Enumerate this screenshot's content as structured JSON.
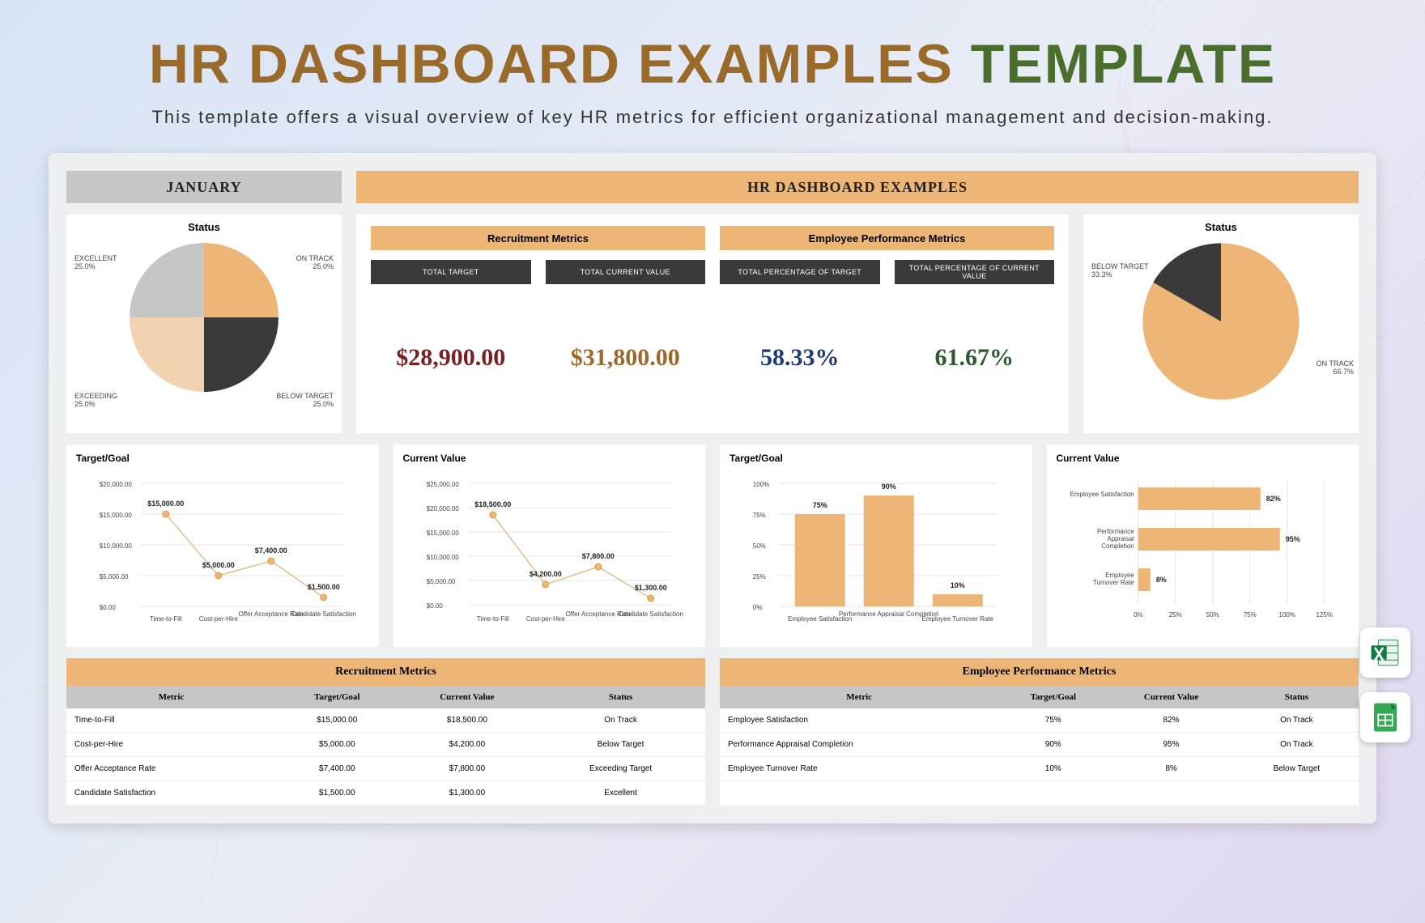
{
  "header": {
    "title_main": "HR DASHBOARD EXAMPLES",
    "title_accent": "TEMPLATE",
    "subtitle": "This template offers a visual overview of key HR metrics for efficient organizational management and decision-making."
  },
  "top": {
    "month": "JANUARY",
    "main_header": "HR DASHBOARD EXAMPLES"
  },
  "pie1": {
    "title": "Status",
    "labels": {
      "excellent": "EXCELLENT",
      "excellent_pct": "25.0%",
      "on_track": "ON TRACK",
      "on_track_pct": "25.0%",
      "exceeding": "EXCEEDING",
      "exceeding_pct": "25.0%",
      "below": "BELOW TARGET",
      "below_pct": "25.0%"
    }
  },
  "pie2": {
    "title": "Status",
    "labels": {
      "below": "BELOW TARGET",
      "below_pct": "33.3%",
      "on_track": "ON TRACK",
      "on_track_pct": "66.7%"
    }
  },
  "metrics": {
    "group1": "Recruitment Metrics",
    "group2": "Employee Performance Metrics",
    "c1_sub": "TOTAL TARGET",
    "c1_val": "$28,900.00",
    "c2_sub": "TOTAL CURRENT VALUE",
    "c2_val": "$31,800.00",
    "c3_sub": "TOTAL PERCENTAGE OF TARGET",
    "c3_val": "58.33%",
    "c4_sub": "TOTAL PERCENTAGE OF CURRENT VALUE",
    "c4_val": "61.67%"
  },
  "mini1": {
    "title": "Target/Goal",
    "xcats": [
      "Time-to-Fill",
      "Cost-per-Hire",
      "Offer Acceptance Rate",
      "Candidate Satisfaction"
    ],
    "labels": [
      "$15,000.00",
      "$5,000.00",
      "$7,400.00",
      "$1,500.00"
    ]
  },
  "mini2": {
    "title": "Current Value",
    "xcats": [
      "Time-to-Fill",
      "Cost-per-Hire",
      "Offer Acceptance Rate",
      "Candidate Satisfaction"
    ],
    "labels": [
      "$18,500.00",
      "$4,200.00",
      "$7,800.00",
      "$1,300.00"
    ]
  },
  "mini3": {
    "title": "Target/Goal",
    "xcats": [
      "Employee Satisfaction",
      "Performance Appraisal Completion",
      "Employee Turnover Rate"
    ],
    "labels": [
      "75%",
      "90%",
      "10%"
    ]
  },
  "mini4": {
    "title": "Current Value",
    "ycats": [
      "Employee Satisfaction",
      "Performance Appraisal Completion",
      "Employee Turnover Rate"
    ],
    "labels": [
      "82%",
      "95%",
      "8%"
    ]
  },
  "tbl1": {
    "header": "Recruitment Metrics",
    "cols": [
      "Metric",
      "Target/Goal",
      "Current Value",
      "Status"
    ],
    "rows": [
      [
        "Time-to-Fill",
        "$15,000.00",
        "$18,500.00",
        "On Track"
      ],
      [
        "Cost-per-Hire",
        "$5,000.00",
        "$4,200.00",
        "Below Target"
      ],
      [
        "Offer Acceptance Rate",
        "$7,400.00",
        "$7,800.00",
        "Exceeding Target"
      ],
      [
        "Candidate Satisfaction",
        "$1,500.00",
        "$1,300.00",
        "Excellent"
      ]
    ]
  },
  "tbl2": {
    "header": "Employee Performance Metrics",
    "cols": [
      "Metric",
      "Target/Goal",
      "Current Value",
      "Status"
    ],
    "rows": [
      [
        "Employee Satisfaction",
        "75%",
        "82%",
        "On Track"
      ],
      [
        "Performance Appraisal Completion",
        "90%",
        "95%",
        "On Track"
      ],
      [
        "Employee Turnover Rate",
        "10%",
        "8%",
        "Below Target"
      ]
    ]
  },
  "chart_data": [
    {
      "type": "pie",
      "title": "Status",
      "categories": [
        "Excellent",
        "On Track",
        "Exceeding",
        "Below Target"
      ],
      "values": [
        25.0,
        25.0,
        25.0,
        25.0
      ]
    },
    {
      "type": "pie",
      "title": "Status",
      "categories": [
        "Below Target",
        "On Track"
      ],
      "values": [
        33.3,
        66.7
      ]
    },
    {
      "type": "line",
      "title": "Target/Goal",
      "categories": [
        "Time-to-Fill",
        "Cost-per-Hire",
        "Offer Acceptance Rate",
        "Candidate Satisfaction"
      ],
      "values": [
        15000,
        5000,
        7400,
        1500
      ],
      "ylabel": "$",
      "ylim": [
        0,
        20000
      ]
    },
    {
      "type": "line",
      "title": "Current Value",
      "categories": [
        "Time-to-Fill",
        "Cost-per-Hire",
        "Offer Acceptance Rate",
        "Candidate Satisfaction"
      ],
      "values": [
        18500,
        4200,
        7800,
        1300
      ],
      "ylabel": "$",
      "ylim": [
        0,
        25000
      ]
    },
    {
      "type": "bar",
      "title": "Target/Goal",
      "categories": [
        "Employee Satisfaction",
        "Performance Appraisal Completion",
        "Employee Turnover Rate"
      ],
      "values": [
        75,
        90,
        10
      ],
      "ylabel": "%",
      "ylim": [
        0,
        100
      ]
    },
    {
      "type": "bar",
      "orientation": "horizontal",
      "title": "Current Value",
      "categories": [
        "Employee Satisfaction",
        "Performance Appraisal Completion",
        "Employee Turnover Rate"
      ],
      "values": [
        82,
        95,
        8
      ],
      "xlabel": "%",
      "xlim": [
        0,
        125
      ]
    }
  ]
}
